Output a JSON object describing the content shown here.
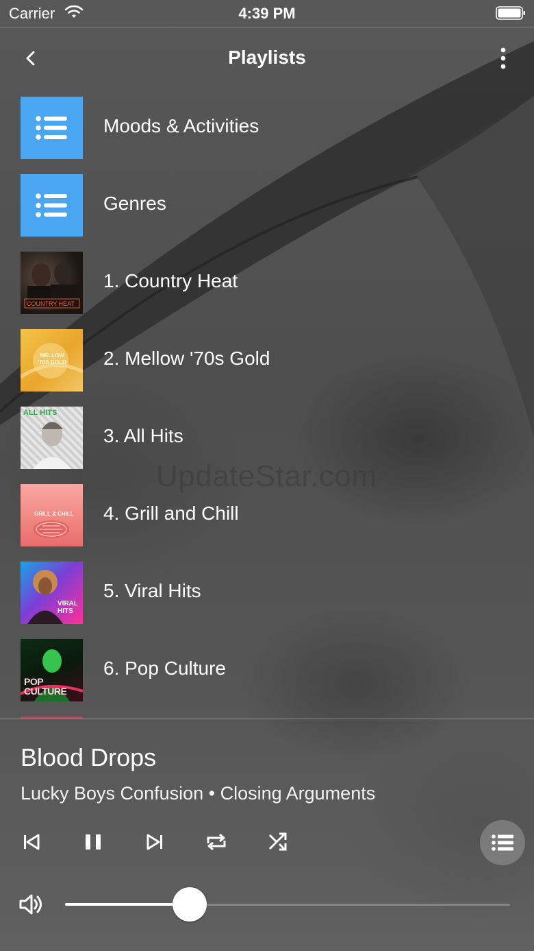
{
  "status_bar": {
    "carrier": "Carrier",
    "time": "4:39 PM"
  },
  "nav": {
    "title": "Playlists"
  },
  "playlists": [
    {
      "label": "Moods & Activities",
      "icon": "list-icon"
    },
    {
      "label": "Genres",
      "icon": "list-icon"
    },
    {
      "label": "1. Country Heat",
      "cover_text": "COUNTRY HEAT"
    },
    {
      "label": "2. Mellow '70s Gold",
      "cover_text": "MELLOW '70S GOLD"
    },
    {
      "label": "3. All Hits",
      "cover_text": "ALL HITS"
    },
    {
      "label": "4. Grill and Chill",
      "cover_text": "GRILL & CHILL"
    },
    {
      "label": "5. Viral Hits",
      "cover_text": "VIRAL HITS"
    },
    {
      "label": "6. Pop Culture",
      "cover_text": "POP CULTURE"
    }
  ],
  "now_playing": {
    "title": "Blood Drops",
    "subtitle": "Lucky Boys Confusion • Closing Arguments",
    "volume": 0.28
  },
  "controls": [
    "previous-icon",
    "pause-icon",
    "next-icon",
    "repeat-icon",
    "shuffle-icon",
    "queue-icon"
  ],
  "watermark": "UpdateStar.com",
  "colors": {
    "list_thumb": "#4aa6f0",
    "text": "#ffffff"
  }
}
